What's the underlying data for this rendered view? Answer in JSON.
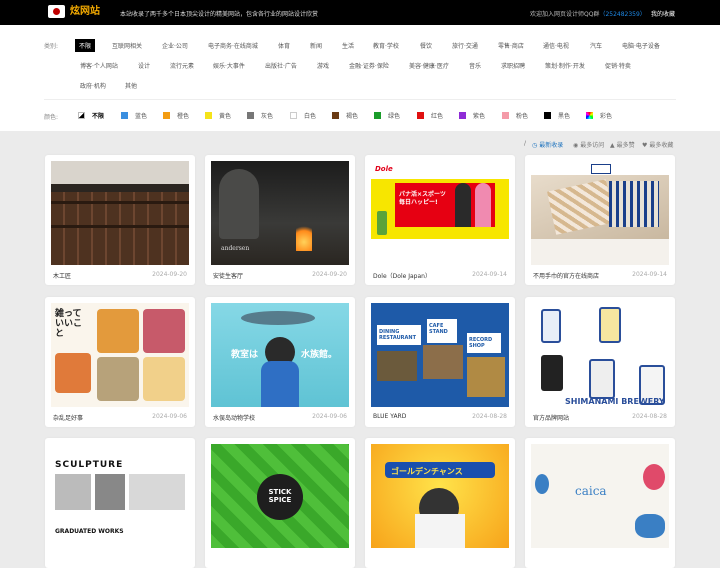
{
  "header": {
    "logo_text": "炫网站",
    "tagline": "本站收录了两千多个日本顶尖设计的精美网站，包含各行业的网站设计欣赏",
    "join_prefix": "欢迎加入网页设计师QQ群",
    "join_qq": "（252482359）",
    "favorite": "我的收藏"
  },
  "filters": {
    "category_label": "类别:",
    "categories": [
      "不限",
      "互联网相关",
      "企业·公司",
      "电子商务·在线商城",
      "体育",
      "新闻",
      "生活",
      "教育·学校",
      "餐饮",
      "旅行·交通",
      "零售·商店",
      "通信·电视",
      "汽车",
      "电脑·电子设备",
      "博客·个人网站",
      "设计",
      "流行元素",
      "娱乐·大事件",
      "出版社·广告",
      "游戏",
      "金融·证券·保险",
      "美容·健康·医疗",
      "音乐",
      "求职招聘",
      "策划·制作·开发",
      "促销·特卖",
      "政府·机构",
      "其他"
    ],
    "color_label": "颜色:",
    "colors": [
      {
        "label": "不限",
        "hex": "#ffffff"
      },
      {
        "label": "蓝色",
        "hex": "#3a8fe0"
      },
      {
        "label": "橙色",
        "hex": "#f39c12"
      },
      {
        "label": "黄色",
        "hex": "#f5e31a"
      },
      {
        "label": "灰色",
        "hex": "#777777"
      },
      {
        "label": "白色",
        "hex": "#ffffff"
      },
      {
        "label": "褐色",
        "hex": "#6b3b14"
      },
      {
        "label": "绿色",
        "hex": "#1a9c2a"
      },
      {
        "label": "红色",
        "hex": "#e01010"
      },
      {
        "label": "紫色",
        "hex": "#8e2bd6"
      },
      {
        "label": "粉色",
        "hex": "#f49aa8"
      },
      {
        "label": "黑色",
        "hex": "#000000"
      },
      {
        "label": "彩色",
        "hex": "#ff00ff"
      }
    ]
  },
  "sort": {
    "slash": "/",
    "items": [
      {
        "label": "最新收录",
        "icon": "clock-icon"
      },
      {
        "label": "最多访问",
        "icon": "eye-icon"
      },
      {
        "label": "最多赞",
        "icon": "thumb-icon"
      },
      {
        "label": "最多收藏",
        "icon": "heart-icon"
      }
    ]
  },
  "sites": [
    {
      "title": "木工匠",
      "date": "2024-09-20"
    },
    {
      "title": "安徒生客厅",
      "date": "2024-09-20"
    },
    {
      "title": "Dole（Dole Japan）",
      "date": "2024-09-14"
    },
    {
      "title": "不用手巾的官方在线商店",
      "date": "2024-09-14"
    },
    {
      "title": "杂乱足好事",
      "date": "2024-09-06"
    },
    {
      "title": "水俣岛动物学校",
      "date": "2024-09-06"
    },
    {
      "title": "BLUE YARD",
      "date": "2024-08-28"
    },
    {
      "title": "官方品牌网站",
      "date": "2024-08-28"
    },
    {
      "title": "",
      "date": ""
    },
    {
      "title": "",
      "date": ""
    },
    {
      "title": "",
      "date": ""
    },
    {
      "title": "",
      "date": ""
    }
  ],
  "thumb_text": {
    "dole_banner": "パナ活×スポーツ 毎日ハッピー!",
    "dole_logo": "Dole",
    "andersen": "andersen",
    "stick_spice": "STICK SPICE",
    "caica": "caica",
    "shimanami": "SHIMANAMI BREWERY",
    "graduated": "GRADUATED WORKS",
    "sculpture": "SCULPTURE",
    "cafe_stand": "CAFE STAND",
    "dining": "DINING RESTAURANT",
    "record": "RECORD SHOP",
    "school_a": "教室は",
    "school_b": "水族館。",
    "kotsu": "雑って いいこと",
    "golden": "ゴールデンチャンス"
  }
}
